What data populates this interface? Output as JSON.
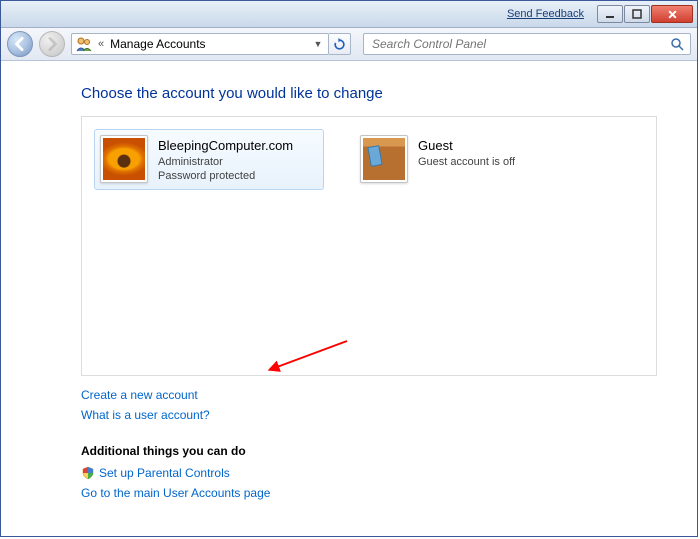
{
  "titlebar": {
    "feedback": "Send Feedback"
  },
  "nav": {
    "breadcrumb_icon": "user-accounts-icon",
    "breadcrumb_back": "«",
    "location": "Manage Accounts"
  },
  "search": {
    "placeholder": "Search Control Panel"
  },
  "heading": "Choose the account you would like to change",
  "accounts": [
    {
      "name": "BleepingComputer.com",
      "role": "Administrator",
      "status": "Password protected",
      "picture": "flower",
      "selected": true
    },
    {
      "name": "Guest",
      "role": "Guest account is off",
      "status": "",
      "picture": "suitcase",
      "selected": false
    }
  ],
  "links": {
    "create": "Create a new account",
    "whatis": "What is a user account?"
  },
  "additional": {
    "heading": "Additional things you can do",
    "parental": "Set up Parental Controls",
    "main": "Go to the main User Accounts page"
  }
}
